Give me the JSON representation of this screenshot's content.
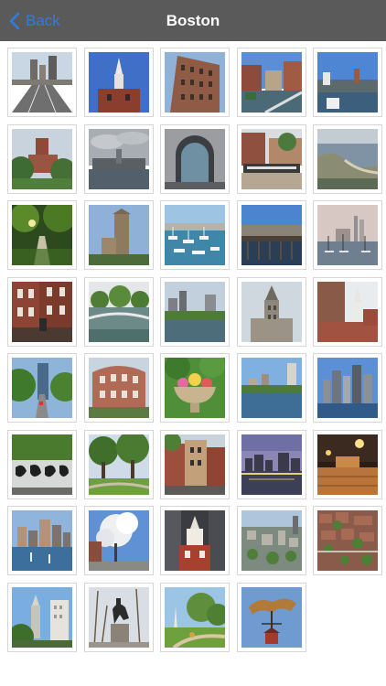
{
  "nav": {
    "back_label": "Back",
    "title": "Boston",
    "accent": "#2f7de1",
    "bar_color": "#5a5a5a"
  },
  "photos": [
    {
      "name": "highway-skyline"
    },
    {
      "name": "church-steeple-blue-sky"
    },
    {
      "name": "brick-tower-building"
    },
    {
      "name": "harbor-buildings-railing"
    },
    {
      "name": "harbor-boardwalk"
    },
    {
      "name": "brick-tower-trees"
    },
    {
      "name": "cloudy-skyline-river"
    },
    {
      "name": "stone-arch-building"
    },
    {
      "name": "wharf-sign-building"
    },
    {
      "name": "aerial-coastline"
    },
    {
      "name": "park-path-trees"
    },
    {
      "name": "stone-monument-tower"
    },
    {
      "name": "marina-boats"
    },
    {
      "name": "waterfront-pier"
    },
    {
      "name": "sailboats-river-skyline"
    },
    {
      "name": "brick-townhouses"
    },
    {
      "name": "river-footbridge"
    },
    {
      "name": "pond-city-view"
    },
    {
      "name": "custom-house-tower"
    },
    {
      "name": "church-tall-building"
    },
    {
      "name": "street-tall-tower"
    },
    {
      "name": "brick-hotel-corner"
    },
    {
      "name": "flower-urn-garden"
    },
    {
      "name": "river-skyline-day"
    },
    {
      "name": "skyline-across-water"
    },
    {
      "name": "graffiti-wall"
    },
    {
      "name": "common-park-trees"
    },
    {
      "name": "brick-row-houses"
    },
    {
      "name": "city-lights-dusk"
    },
    {
      "name": "night-plaza"
    },
    {
      "name": "harbor-skyline-boats"
    },
    {
      "name": "white-blossom-tree"
    },
    {
      "name": "old-state-house"
    },
    {
      "name": "aerial-city-view"
    },
    {
      "name": "aerial-rooftops"
    },
    {
      "name": "custom-house-trees"
    },
    {
      "name": "horseman-statue"
    },
    {
      "name": "park-monument-path"
    },
    {
      "name": "lobster-weathervane"
    }
  ]
}
